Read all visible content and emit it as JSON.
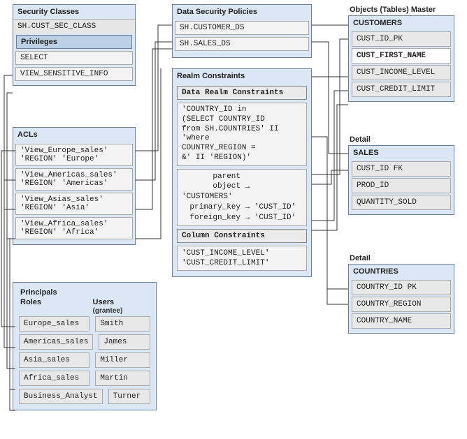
{
  "sec_classes": {
    "title": "Security Classes",
    "item": "SH.CUST_SEC_CLASS",
    "privileges_title": "Privileges",
    "priv1": "SELECT",
    "priv2": "VIEW_SENSITIVE_INFO"
  },
  "acls": {
    "title": "ACLs",
    "a1_name": "'View_Europe_sales'",
    "a1_region": "'REGION' 'Europe'",
    "a2_name": "'View_Americas_sales'",
    "a2_region": "'REGION' 'Americas'",
    "a3_name": "'View_Asias_sales'",
    "a3_region": "'REGION' 'Asia'",
    "a4_name": "'View_Africa_sales'",
    "a4_region": "'REGION' 'Africa'"
  },
  "principals": {
    "title": "Principals",
    "roles_header": "Roles",
    "users_header": "Users",
    "users_sub": "(grantee)",
    "r1": "Europe_sales",
    "u1": "Smith",
    "r2": "Americas_sales",
    "u2": "James",
    "r3": "Asia_sales",
    "u3": "Miller",
    "r4": "Africa_sales",
    "u4": "Martin",
    "r5": "Business_Analyst",
    "u5": "Turner"
  },
  "policies": {
    "title": "Data Security Policies",
    "p1": "SH.CUSTOMER_DS",
    "p2": "SH.SALES_DS"
  },
  "realm": {
    "title": "Realm Constraints",
    "data_title": "Data Realm Constraints",
    "data_l1": "'COUNTRY_ID in",
    "data_l2": "(SELECT COUNTRY_ID",
    "data_l3": "from SH.COUNTRIES' II",
    "data_l4": "'where",
    "data_l5": "COUNTRY_REGION =",
    "data_l6": "&' II 'REGION)'",
    "po_label": "parent object",
    "po_val": "'CUSTOMERS'",
    "pk_label": "primary_key",
    "pk_val": "'CUST_ID'",
    "fk_label": "foreign_key",
    "fk_val": "'CUST_ID'",
    "col_title": "Column Constraints",
    "col_l1": "'CUST_INCOME_LEVEL'",
    "col_l2": "'CUST_CREDIT_LIMIT'"
  },
  "objects": {
    "header": "Objects (Tables) Master",
    "customers": {
      "title": "CUSTOMERS",
      "c1": "CUST_ID_PK",
      "c2": "CUST_FIRST_NAME",
      "c3": "CUST_INCOME_LEVEL",
      "c4": "CUST_CREDIT_LIMIT"
    },
    "detail1": "Detail",
    "sales": {
      "title": "SALES",
      "c1": "CUST_ID FK",
      "c2": "PROD_ID",
      "c3": "QUANTITY_SOLD"
    },
    "detail2": "Detail",
    "countries": {
      "title": "COUNTRIES",
      "c1": "COUNTRY_ID PK",
      "c2": "COUNTRY_REGION",
      "c3": "COUNTRY_NAME"
    }
  }
}
